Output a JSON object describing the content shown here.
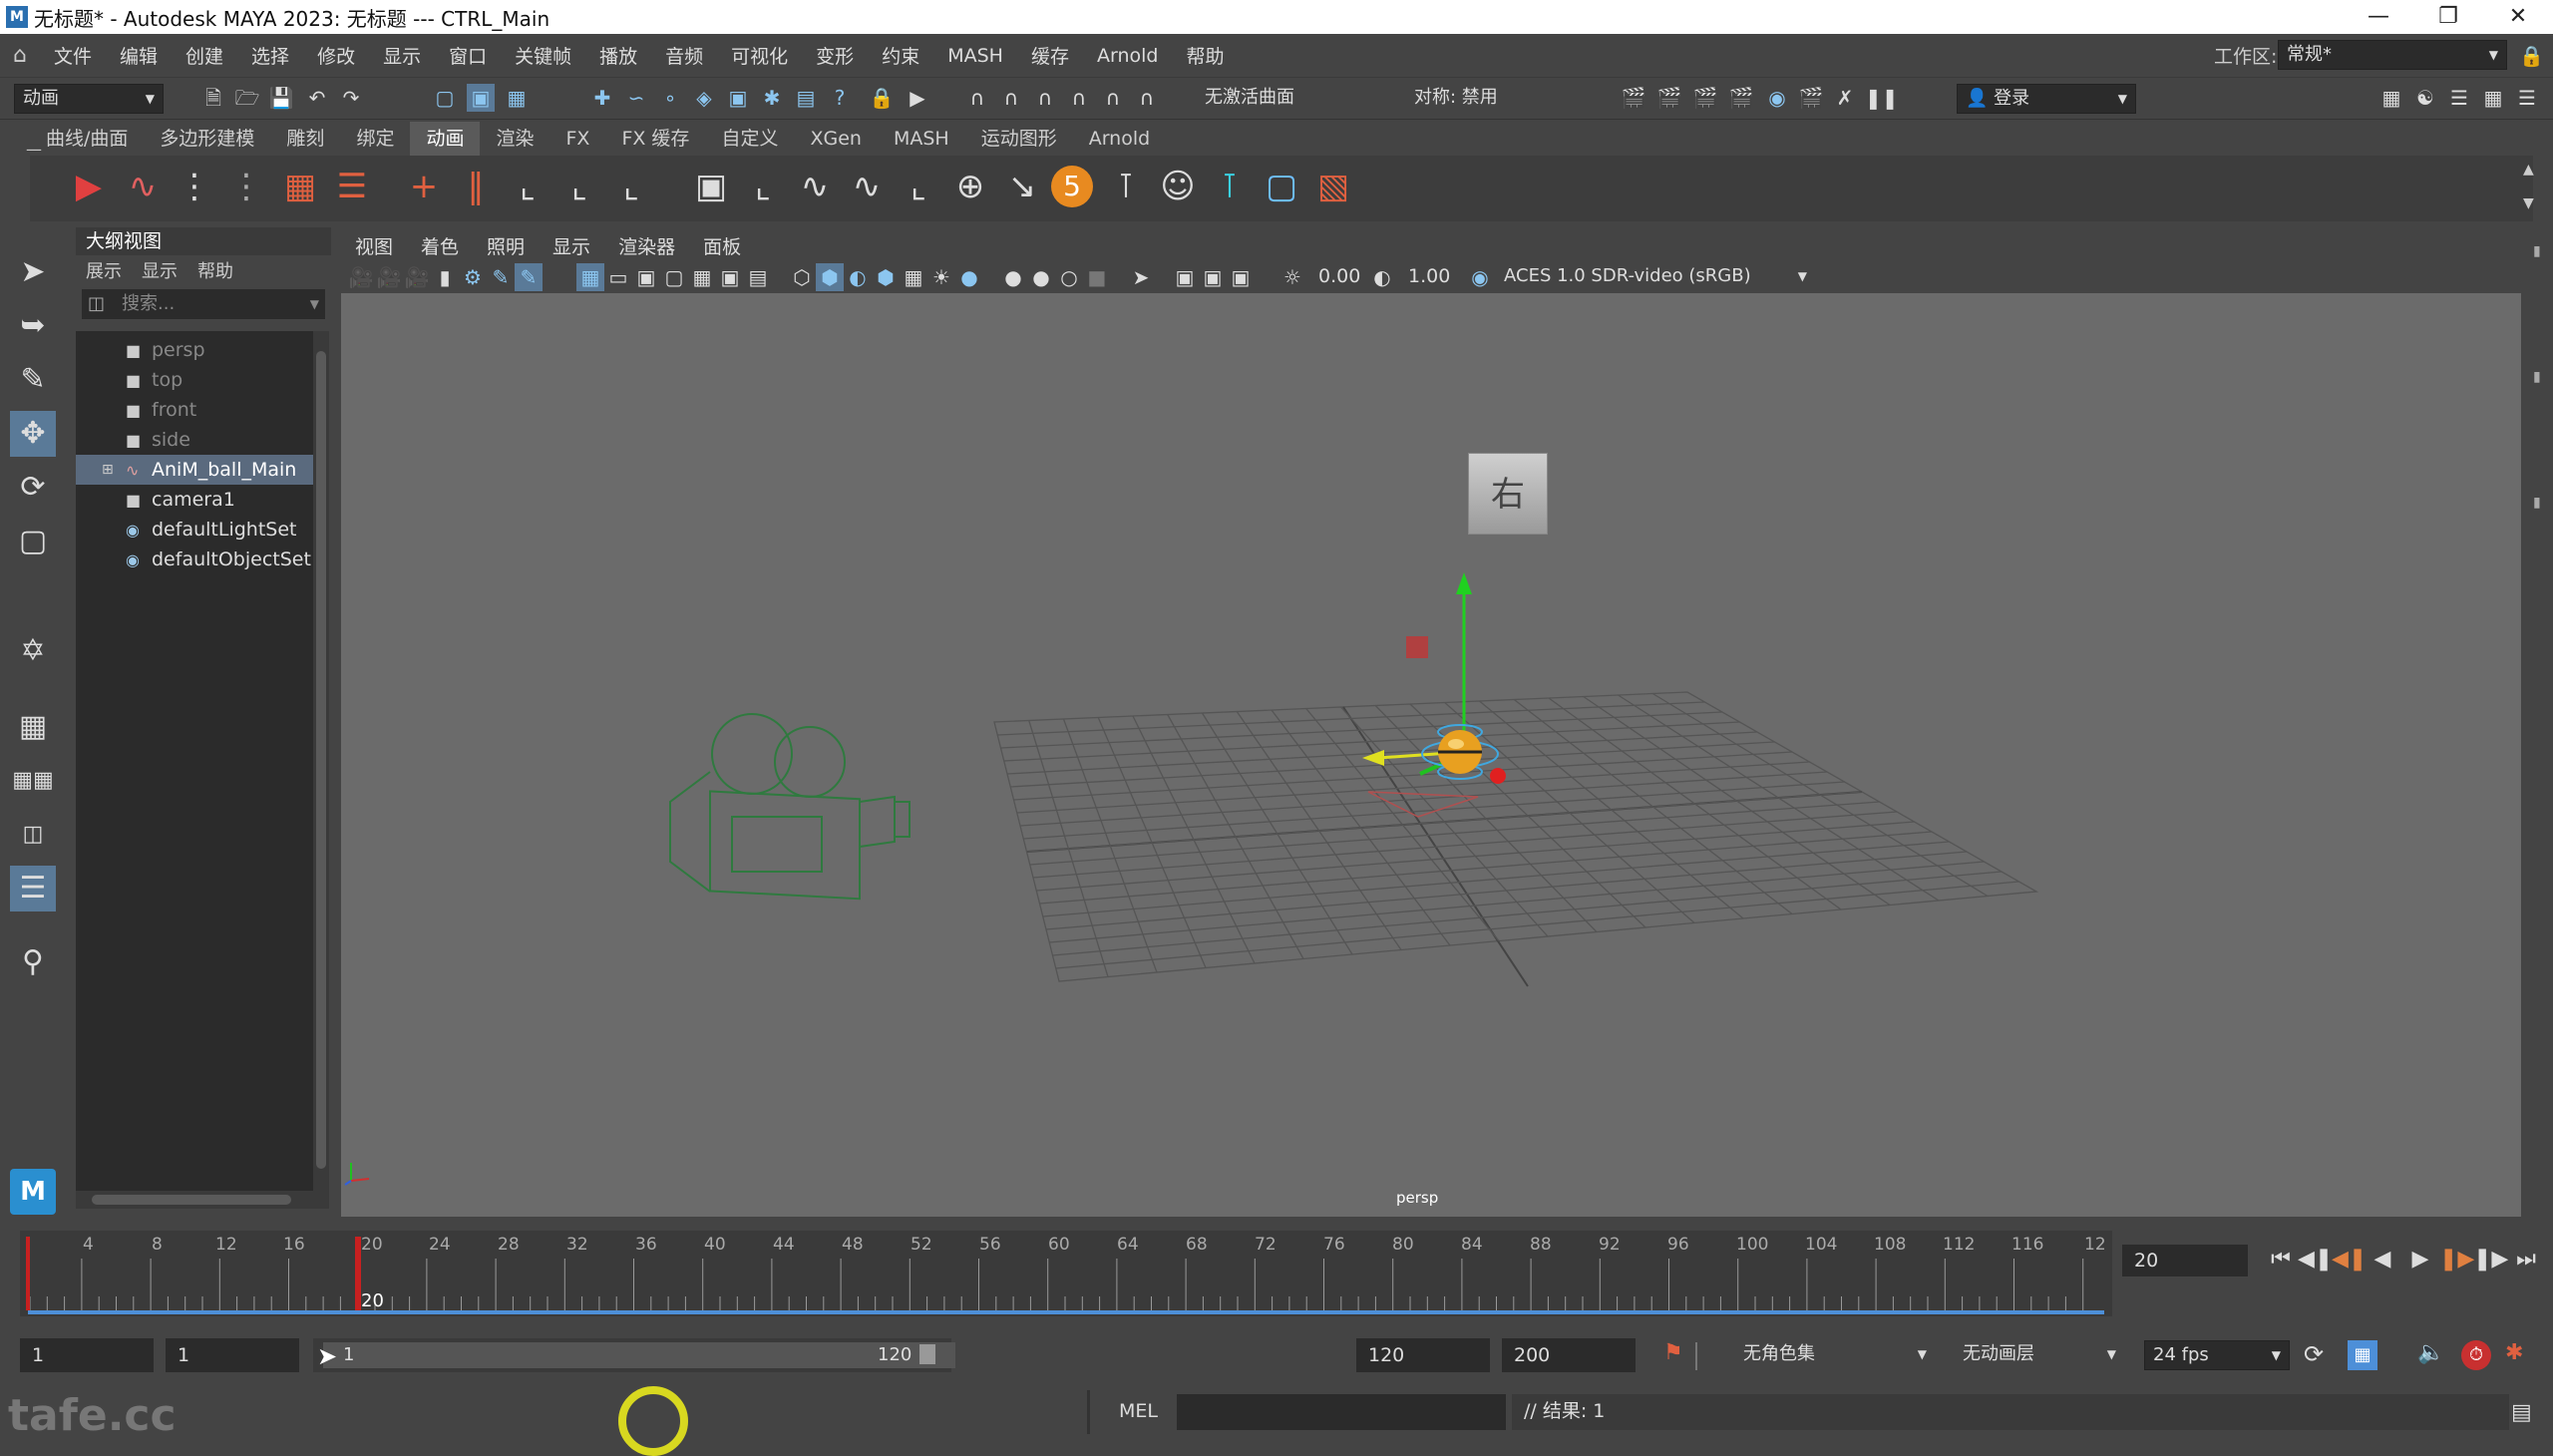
{
  "window": {
    "title": "无标题* - Autodesk MAYA 2023: 无标题   ---   CTRL_Main",
    "app_icon": "M"
  },
  "menubar": {
    "items": [
      "文件",
      "编辑",
      "创建",
      "选择",
      "修改",
      "显示",
      "窗口",
      "关键帧",
      "播放",
      "音频",
      "可视化",
      "变形",
      "约束",
      "MASH",
      "缓存",
      "Arnold",
      "帮助"
    ],
    "workspace_label": "工作区:",
    "workspace_value": "常规*"
  },
  "statusline": {
    "mode": "动画",
    "live_surface": "无激活曲面",
    "symmetry": "对称: 禁用",
    "login": "登录"
  },
  "shelf": {
    "tabs": [
      "曲线/曲面",
      "多边形建模",
      "雕刻",
      "绑定",
      "动画",
      "渲染",
      "FX",
      "FX 缓存",
      "自定义",
      "XGen",
      "MASH",
      "运动图形",
      "Arnold"
    ],
    "active_tab": "动画"
  },
  "outliner": {
    "title": "大纲视图",
    "menu": [
      "展示",
      "显示",
      "帮助"
    ],
    "search_placeholder": "搜索...",
    "items": [
      {
        "label": "persp",
        "dim": true
      },
      {
        "label": "top",
        "dim": true
      },
      {
        "label": "front",
        "dim": true
      },
      {
        "label": "side",
        "dim": true
      },
      {
        "label": "AniM_ball_Main",
        "selected": true
      },
      {
        "label": "camera1"
      },
      {
        "label": "defaultLightSet"
      },
      {
        "label": "defaultObjectSet"
      }
    ]
  },
  "viewport": {
    "menu": [
      "视图",
      "着色",
      "照明",
      "显示",
      "渲染器",
      "面板"
    ],
    "exposure": "0.00",
    "gamma": "1.00",
    "color_space": "ACES 1.0 SDR-video (sRGB)",
    "camera_label": "persp",
    "viewcube_label": "右"
  },
  "timeline": {
    "ticks": [
      "4",
      "8",
      "12",
      "16",
      "20",
      "24",
      "28",
      "32",
      "36",
      "40",
      "44",
      "48",
      "52",
      "56",
      "60",
      "64",
      "68",
      "72",
      "76",
      "80",
      "84",
      "88",
      "92",
      "96",
      "100",
      "104",
      "108",
      "112",
      "116",
      "12"
    ],
    "current_frame_label": "20",
    "current_frame_field": "20"
  },
  "range": {
    "start": "1",
    "playback_start": "1",
    "slider_start": "1",
    "slider_end": "120",
    "playback_end": "120",
    "end": "200",
    "character_set": "无角色集",
    "anim_layer": "无动画层",
    "fps": "24 fps"
  },
  "cmdline": {
    "lang": "MEL",
    "result": "// 结果: 1"
  },
  "watermark": "tafe.cc",
  "colors": {
    "accent_blue": "#5aa0d8",
    "current_time_red": "#e03030",
    "ball_orange": "#e8a020"
  }
}
